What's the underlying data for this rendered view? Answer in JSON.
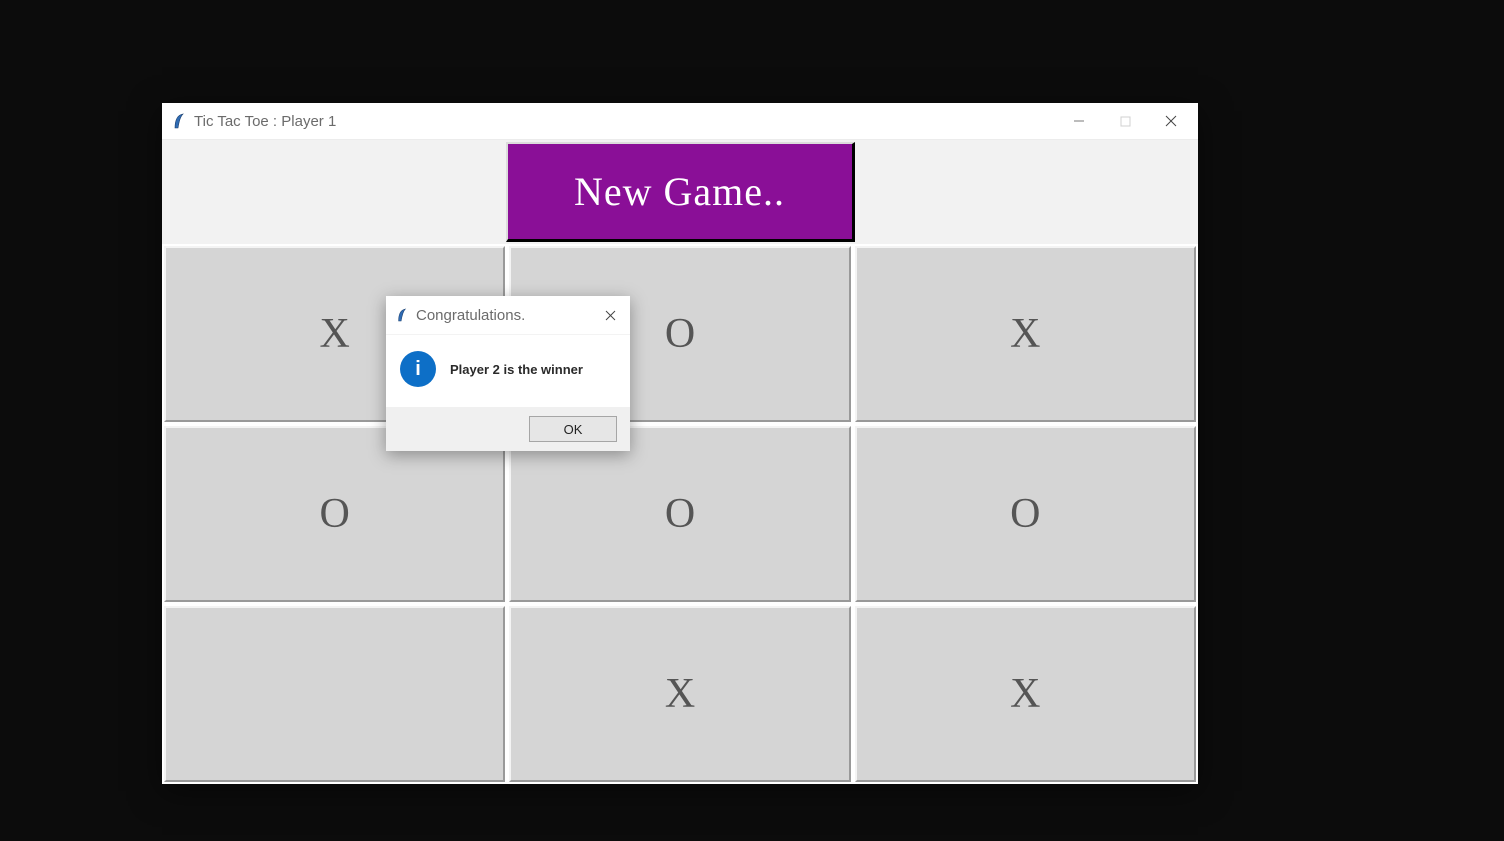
{
  "window": {
    "title": "Tic Tac Toe : Player 1",
    "icon": "tk-icon"
  },
  "toolbar": {
    "new_game_label": "New Game.."
  },
  "board": {
    "cells": [
      "X",
      "O",
      "X",
      "O",
      "O",
      "O",
      "",
      "X",
      "X"
    ]
  },
  "dialog": {
    "title": "Congratulations.",
    "message": "Player 2 is the winner",
    "ok_label": "OK",
    "info_glyph": "i"
  }
}
